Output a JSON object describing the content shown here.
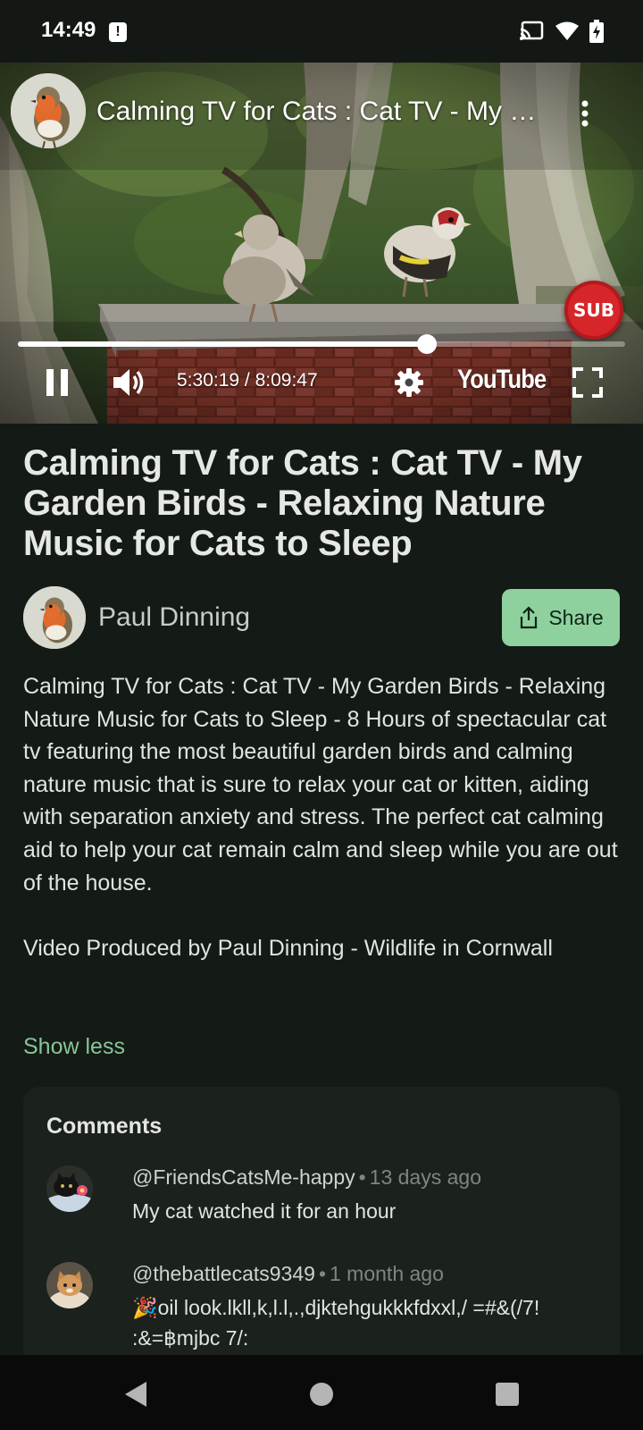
{
  "status_bar": {
    "time": "14:49",
    "alert_glyph": "!",
    "icons": [
      "notification-alert-icon",
      "cast-icon",
      "wifi-icon",
      "battery-charging-icon"
    ]
  },
  "player": {
    "title": "Calming TV for Cats : Cat TV - My Garden Birds - Relaxing Nature Music for Cats to Sleep",
    "subscribe_badge": "SUB",
    "time_readout": "5:30:19 / 8:09:47",
    "progress_fraction": 0.674,
    "brand": "YouTube",
    "icons": [
      "more-vert-icon",
      "pause-icon",
      "volume-icon",
      "settings-gear-icon",
      "fullscreen-icon"
    ]
  },
  "video": {
    "title": "Calming TV for Cats : Cat TV - My Garden Birds - Relaxing Nature Music for Cats to Sleep",
    "uploader": "Paul Dinning",
    "share_label": "Share",
    "description_paragraphs": [
      "Calming TV for Cats : Cat TV - My Garden Birds - Relaxing Nature Music for Cats to Sleep - 8 Hours of spectacular cat tv featuring the most beautiful garden birds and calming nature music that is sure to relax your cat or kitten, aiding with separation anxiety and stress. The perfect cat calming aid to help your cat remain calm and sleep while you are out of the house.",
      "Video Produced by Paul Dinning - Wildlife in Cornwall"
    ],
    "show_less_label": "Show less"
  },
  "comments": {
    "heading": "Comments",
    "separator": "•",
    "items": [
      {
        "author": "@FriendsCatsMe-happy",
        "time": "13 days ago",
        "text": "My cat watched it for an hour"
      },
      {
        "author": "@thebattlecats9349",
        "time": "1 month ago",
        "text": "🎉oil look.lkll,k,l.l,.,djktehgukkkfdxxl,/ =#&(/7!  :&=฿mjbc 7/:"
      }
    ]
  },
  "colors": {
    "background": "#141a16",
    "accent_green": "#8fd19e",
    "show_less": "#88c595",
    "subscribe_red": "#d7262a"
  }
}
